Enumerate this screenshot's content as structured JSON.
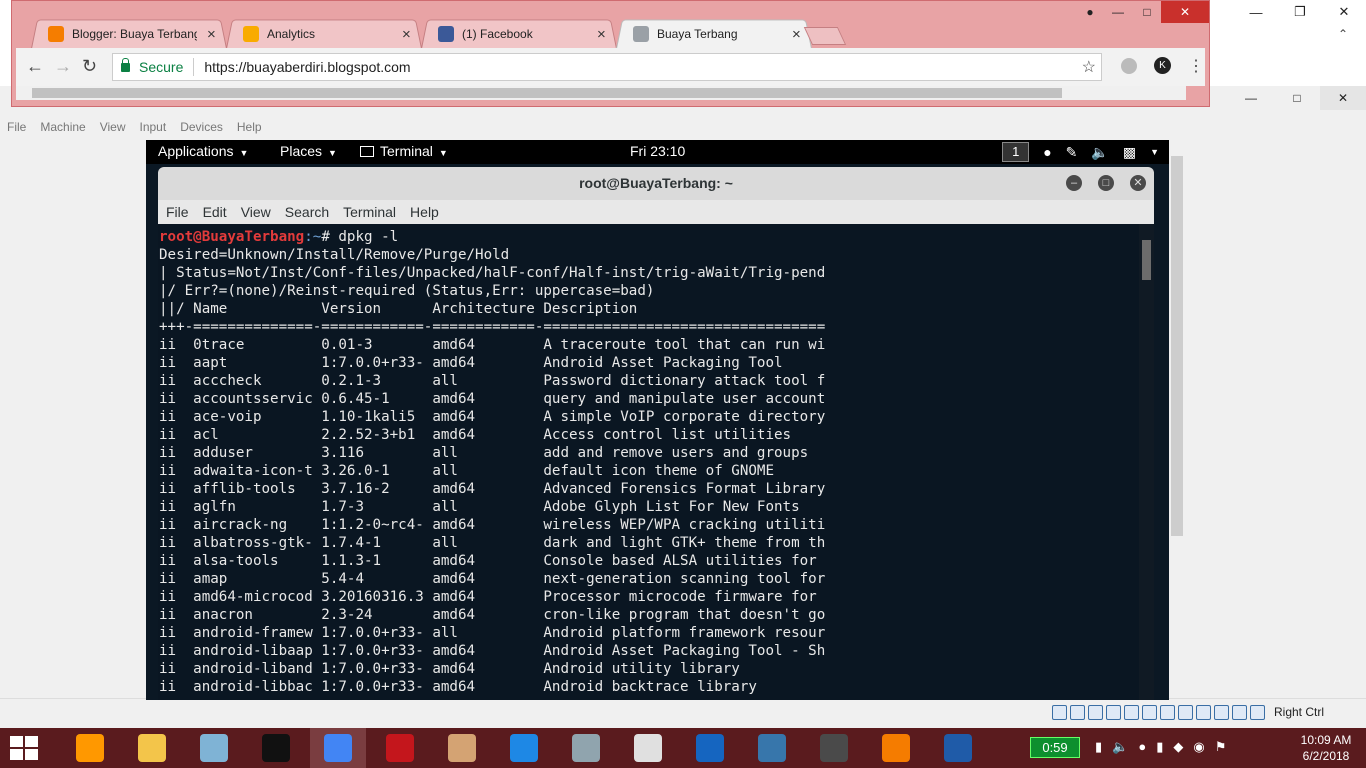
{
  "chrome": {
    "tabs": [
      {
        "title": "Blogger: Buaya Terbang",
        "color": "#f57d00"
      },
      {
        "title": "Analytics",
        "color": "#f9ab00"
      },
      {
        "title": "(1) Facebook",
        "color": "#3b5998"
      },
      {
        "title": "Buaya Terbang",
        "color": "#9aa0a6"
      }
    ],
    "secure_label": "Secure",
    "url": "https://buayaberdiri.blogspot.com",
    "avatar_letter": "K"
  },
  "vbox": {
    "menu": [
      "File",
      "Machine",
      "View",
      "Input",
      "Devices",
      "Help"
    ],
    "host_key": "Right Ctrl"
  },
  "gnome": {
    "applications": "Applications",
    "places": "Places",
    "terminal": "Terminal",
    "clock": "Fri 23:10",
    "workspace": "1"
  },
  "terminal": {
    "title": "root@BuayaTerbang: ~",
    "menu": [
      "File",
      "Edit",
      "View",
      "Search",
      "Terminal",
      "Help"
    ],
    "prompt_user": "root@BuayaTerbang",
    "prompt_path": ":~",
    "prompt_cmd": "# dpkg -l",
    "lines": [
      "Desired=Unknown/Install/Remove/Purge/Hold",
      "| Status=Not/Inst/Conf-files/Unpacked/halF-conf/Half-inst/trig-aWait/Trig-pend",
      "|/ Err?=(none)/Reinst-required (Status,Err: uppercase=bad)",
      "||/ Name           Version      Architecture Description",
      "+++-==============-============-============-=================================",
      "ii  0trace         0.01-3       amd64        A traceroute tool that can run wi",
      "ii  aapt           1:7.0.0+r33- amd64        Android Asset Packaging Tool",
      "ii  acccheck       0.2.1-3      all          Password dictionary attack tool f",
      "ii  accountsservic 0.6.45-1     amd64        query and manipulate user account",
      "ii  ace-voip       1.10-1kali5  amd64        A simple VoIP corporate directory",
      "ii  acl            2.2.52-3+b1  amd64        Access control list utilities",
      "ii  adduser        3.116        all          add and remove users and groups",
      "ii  adwaita-icon-t 3.26.0-1     all          default icon theme of GNOME",
      "ii  afflib-tools   3.7.16-2     amd64        Advanced Forensics Format Library",
      "ii  aglfn          1.7-3        all          Adobe Glyph List For New Fonts",
      "ii  aircrack-ng    1:1.2-0~rc4- amd64        wireless WEP/WPA cracking utiliti",
      "ii  albatross-gtk- 1.7.4-1      all          dark and light GTK+ theme from th",
      "ii  alsa-tools     1.1.3-1      amd64        Console based ALSA utilities for",
      "ii  amap           5.4-4        amd64        next-generation scanning tool for",
      "ii  amd64-microcod 3.20160316.3 amd64        Processor microcode firmware for",
      "ii  anacron        2.3-24       amd64        cron-like program that doesn't go",
      "ii  android-framew 1:7.0.0+r33- all          Android platform framework resour",
      "ii  android-libaap 1:7.0.0+r33- amd64        Android Asset Packaging Tool - Sh",
      "ii  android-liband 1:7.0.0+r33- amd64        Android utility library",
      "ii  android-libbac 1:7.0.0+r33- amd64        Android backtrace library"
    ]
  },
  "taskbar": {
    "apps": [
      {
        "name": "sublime-text",
        "color": "#ff9800"
      },
      {
        "name": "file-explorer",
        "color": "#f3c54a"
      },
      {
        "name": "notepad",
        "color": "#7fb3d5"
      },
      {
        "name": "command-prompt",
        "color": "#111111"
      },
      {
        "name": "chrome",
        "color": "#4285f4"
      },
      {
        "name": "garena",
        "color": "#c4161c"
      },
      {
        "name": "paint",
        "color": "#d4a373"
      },
      {
        "name": "internet-explorer",
        "color": "#1e88e5"
      },
      {
        "name": "remote-desktop",
        "color": "#90a4ae"
      },
      {
        "name": "compass-app",
        "color": "#e0e0e0"
      },
      {
        "name": "defender",
        "color": "#1565c0"
      },
      {
        "name": "python",
        "color": "#3776ab"
      },
      {
        "name": "nox",
        "color": "#4a4a4a"
      },
      {
        "name": "media-player",
        "color": "#f57c00"
      },
      {
        "name": "virtualbox",
        "color": "#1f5ba8"
      }
    ],
    "timer": "0:59",
    "time": "10:09 AM",
    "date": "6/2/2018"
  }
}
